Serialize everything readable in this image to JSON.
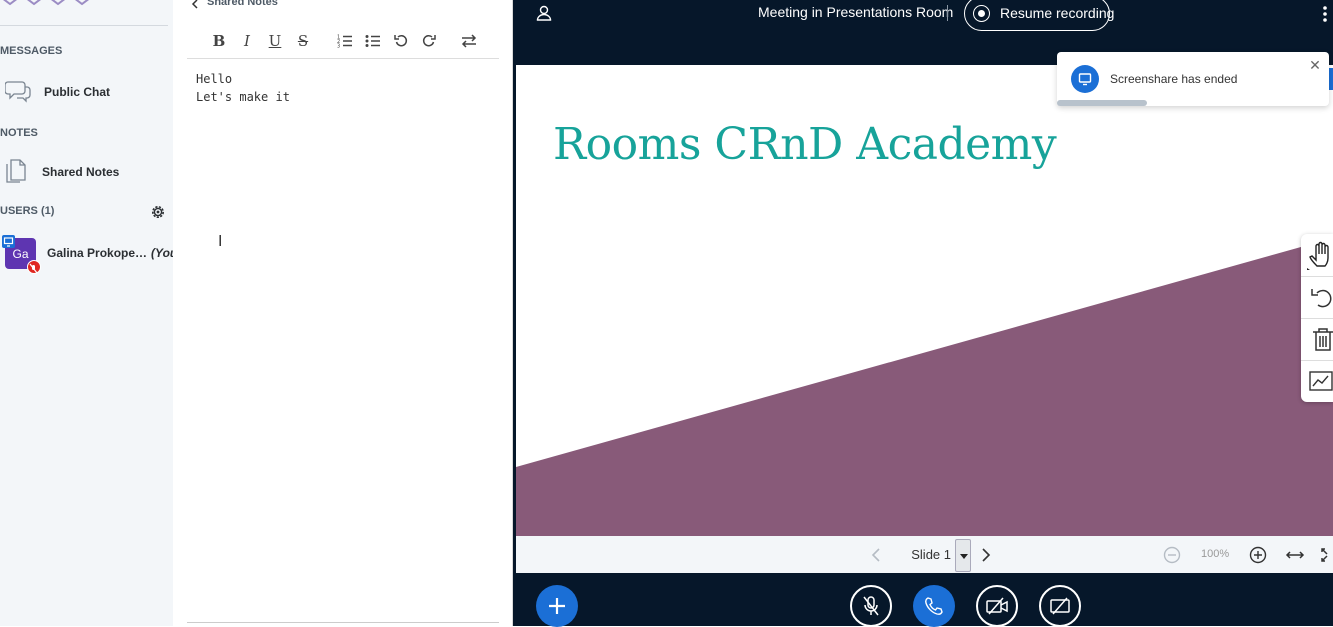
{
  "sidebar": {
    "messages_title": "MESSAGES",
    "public_chat": "Public Chat",
    "notes_title": "NOTES",
    "shared_notes": "Shared Notes",
    "users_title": "USERS (1)",
    "user": {
      "initials": "Ga",
      "name": "Galina Prokope…",
      "you": "(You)"
    }
  },
  "notes": {
    "header": "Shared Notes",
    "lines": [
      "Hello",
      "Let's make it"
    ],
    "toolbar_icons": [
      "bold-icon",
      "italic-icon",
      "underline-icon",
      "strikethrough-icon",
      "ordered-list-icon",
      "unordered-list-icon",
      "undo-icon",
      "redo-icon",
      "swap-icon"
    ]
  },
  "topbar": {
    "meeting_title": "Meeting in Presentations Room",
    "record_label": "Resume recording"
  },
  "toast": {
    "message": "Screenshare has ended",
    "progress": 0.33
  },
  "slide": {
    "title": "Rooms CRnD Academy",
    "title_color": "#17a39a",
    "shape_color": "#885a79"
  },
  "slidebar": {
    "slide_label": "Slide 1",
    "zoom": "100%"
  },
  "colors": {
    "accent": "#1b6fd6",
    "dark_bg": "#06172a",
    "avatar": "#5e35b1",
    "mic_muted": "#df2721"
  }
}
